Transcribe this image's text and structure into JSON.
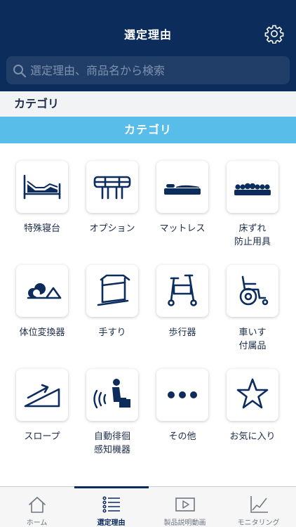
{
  "header": {
    "title": "選定理由",
    "settings_icon": "gear-icon"
  },
  "search": {
    "placeholder": "選定理由、商品名から検索",
    "value": "",
    "icon": "search-icon"
  },
  "section": {
    "title": "カテゴリ"
  },
  "category_bar": {
    "label": "カテゴリ"
  },
  "categories": [
    {
      "label": "特殊寝台",
      "icon": "care-bed-icon"
    },
    {
      "label": "オプション",
      "icon": "bed-rail-icon"
    },
    {
      "label": "マットレス",
      "icon": "mattress-icon"
    },
    {
      "label": "床ずれ\n防止用具",
      "icon": "pressure-mattress-icon"
    },
    {
      "label": "体位変換器",
      "icon": "positioning-cushion-icon"
    },
    {
      "label": "手すり",
      "icon": "handrail-icon"
    },
    {
      "label": "歩行器",
      "icon": "walker-icon"
    },
    {
      "label": "車いす\n付属品",
      "icon": "wheelchair-icon"
    },
    {
      "label": "スロープ",
      "icon": "ramp-icon"
    },
    {
      "label": "自動徘徊\n感知機器",
      "icon": "wander-sensor-icon"
    },
    {
      "label": "その他",
      "icon": "more-dots-icon"
    },
    {
      "label": "お気に入り",
      "icon": "star-icon"
    }
  ],
  "tabs": [
    {
      "label": "ホーム",
      "icon": "home-icon",
      "active": false
    },
    {
      "label": "選定理由",
      "icon": "list-icon",
      "active": true
    },
    {
      "label": "製品説明動画",
      "icon": "video-play-icon",
      "active": false
    },
    {
      "label": "モニタリング",
      "icon": "line-chart-icon",
      "active": false
    }
  ],
  "colors": {
    "header_bg": "#0c2c5c",
    "search_bg": "#213e69",
    "category_bar_bg": "#58bde8",
    "icon_navy": "#0c2c5c",
    "section_bg": "#f2f3f5"
  }
}
